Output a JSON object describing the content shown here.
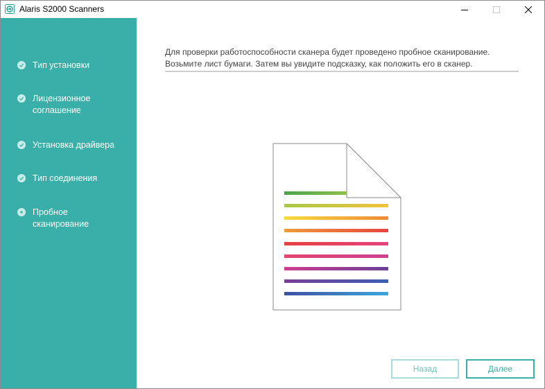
{
  "window": {
    "title": "Alaris S2000 Scanners",
    "icon": "scanner-app-icon",
    "controls": [
      "minimize-icon",
      "maximize-icon",
      "close-icon"
    ]
  },
  "sidebar": {
    "background": "#3aafa9",
    "steps": [
      {
        "label": "Тип установки",
        "state": "done",
        "icon": "check-icon"
      },
      {
        "label": "Лицензионное соглашение",
        "state": "done",
        "icon": "check-icon"
      },
      {
        "label": "Установка драйвера",
        "state": "done",
        "icon": "check-icon"
      },
      {
        "label": "Тип соединения",
        "state": "done",
        "icon": "check-icon"
      },
      {
        "label": "Пробное сканирование",
        "state": "current",
        "icon": "dot-icon"
      }
    ]
  },
  "main": {
    "instruction": "Для проверки работоспособности сканера будет проведено пробное сканирование. Возьмите лист бумаги. Затем вы увидите подсказку, как положить его в сканер.",
    "illustration": "document-page-icon"
  },
  "buttons": {
    "back_label": "Назад",
    "next_label": "Далее"
  },
  "colors": {
    "accent": "#3aafa9",
    "step_marker": "#c9ece9"
  }
}
